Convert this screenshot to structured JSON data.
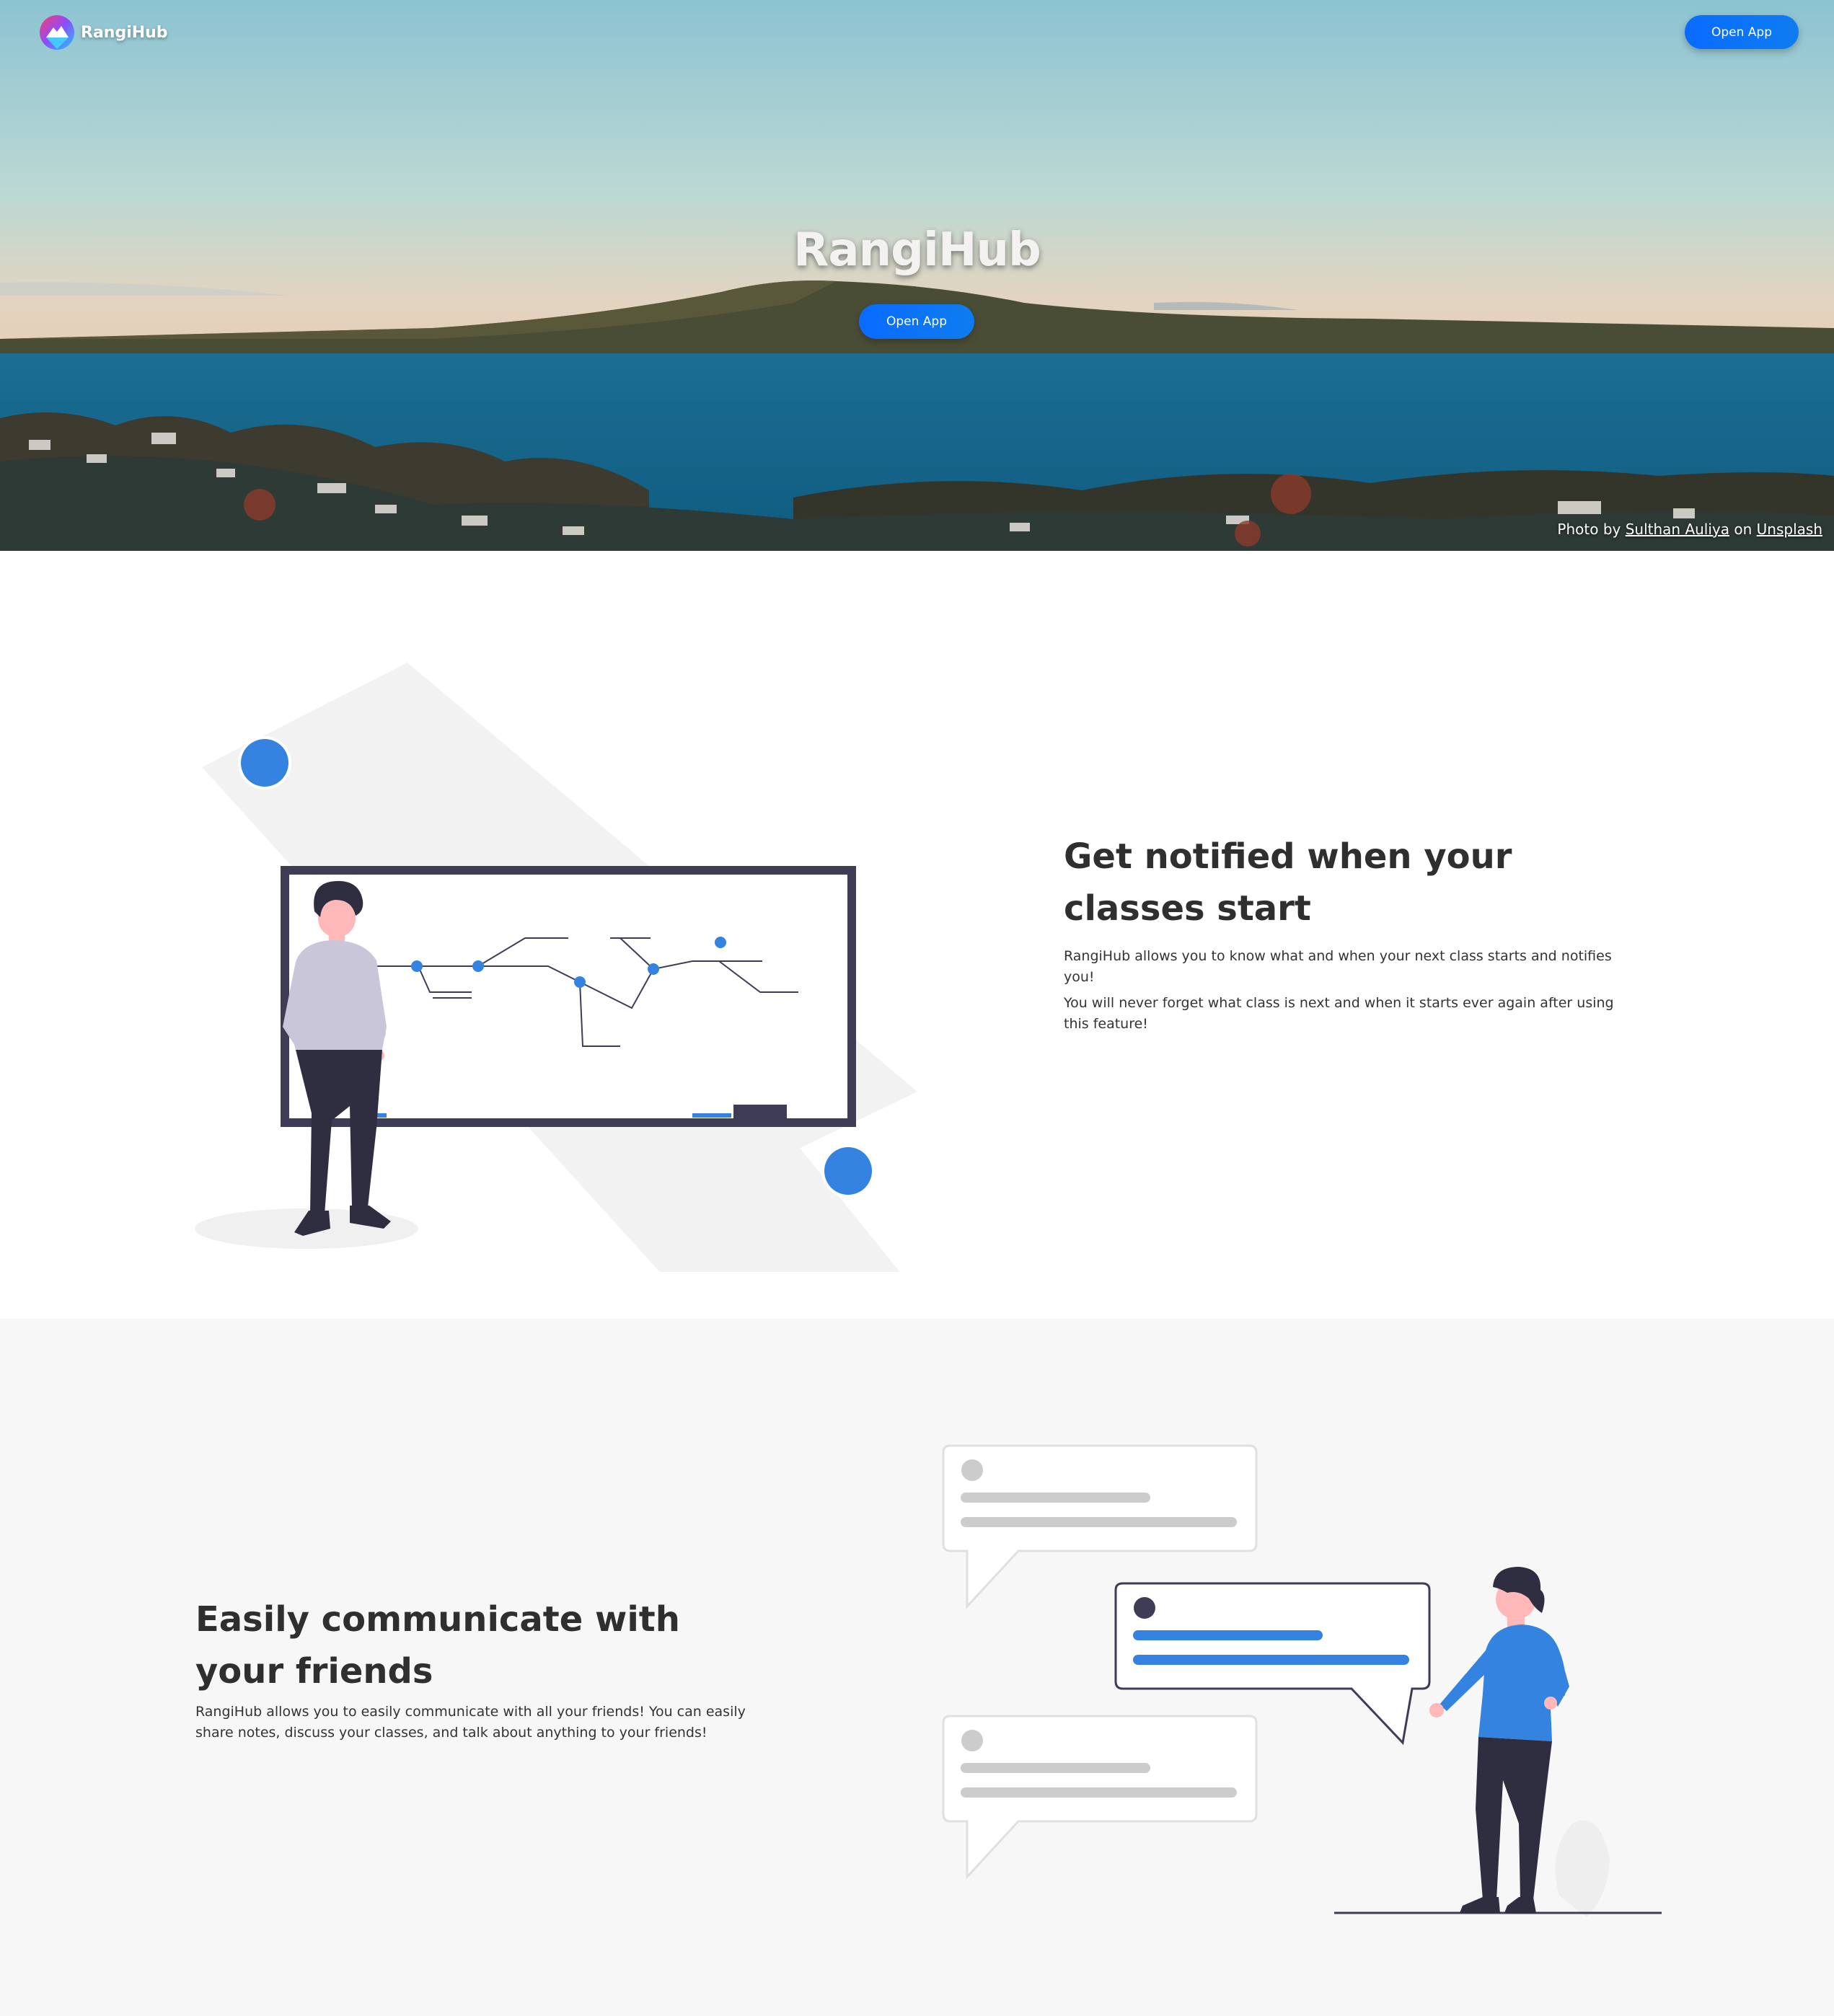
{
  "brand": {
    "name": "RangiHub"
  },
  "nav": {
    "open_app_label": "Open App"
  },
  "hero": {
    "title": "RangiHub",
    "open_app_label": "Open App",
    "credit": {
      "prefix": "Photo by ",
      "author": "Sulthan Auliya",
      "middle": " on ",
      "site": "Unsplash"
    }
  },
  "features": [
    {
      "title": "Get notified when your classes start",
      "paragraphs": [
        "RangiHub allows you to know what and when your next class starts and notifies you!",
        "You will never forget what class is next and when it starts ever again after using this feature!"
      ]
    },
    {
      "title": "Easily communicate with your friends",
      "paragraphs": [
        "RangiHub allows you to easily communicate with all your friends! You can easily share notes, discuss your classes, and talk about anything to your friends!"
      ]
    }
  ],
  "colors": {
    "accent": "#0a6bff",
    "illustration_blue": "#3483e0",
    "ink": "#3f3d56",
    "section_gray": "#f7f7f7"
  },
  "icons": {
    "brand_logo": "rangihub-logo-icon"
  }
}
